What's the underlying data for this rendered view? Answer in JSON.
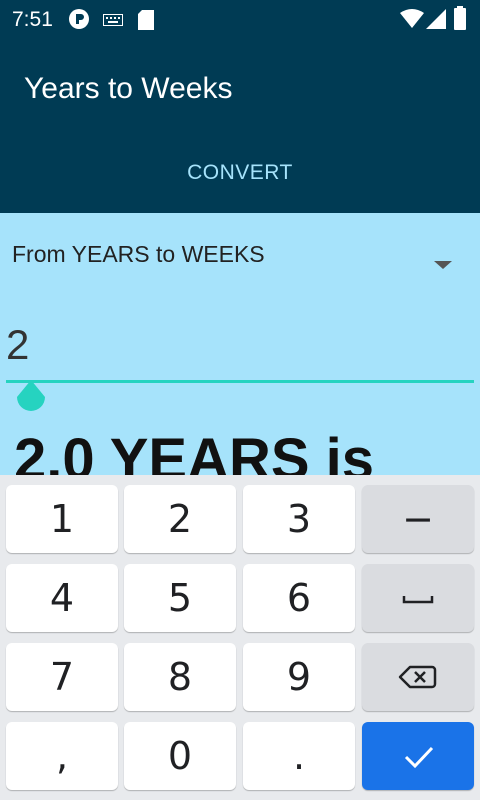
{
  "status_bar": {
    "time": "7:51",
    "icons": [
      "app-notification-icon",
      "keyboard-icon",
      "sd-card-icon",
      "wifi-icon",
      "signal-icon",
      "battery-icon"
    ]
  },
  "app_bar": {
    "title": "Years to Weeks"
  },
  "tabs": {
    "convert_label": "CONVERT"
  },
  "converter": {
    "spinner_selected": "From YEARS to WEEKS",
    "input_value": "2",
    "result_text": "2.0 YEARS is"
  },
  "keyboard": {
    "rows": [
      [
        "1",
        "2",
        "3",
        "−"
      ],
      [
        "4",
        "5",
        "6",
        "space"
      ],
      [
        "7",
        "8",
        "9",
        "backspace"
      ],
      [
        ",",
        "0",
        ".",
        "done"
      ]
    ],
    "key_1": "1",
    "key_2": "2",
    "key_3": "3",
    "key_minus": "−",
    "key_4": "4",
    "key_5": "5",
    "key_6": "6",
    "key_7": "7",
    "key_8": "8",
    "key_9": "9",
    "key_comma": ",",
    "key_0": "0",
    "key_period": "."
  },
  "colors": {
    "app_bar": "#003b54",
    "content_bg": "#a6e3fb",
    "accent": "#26d3c0",
    "done_key": "#1a73e8"
  }
}
